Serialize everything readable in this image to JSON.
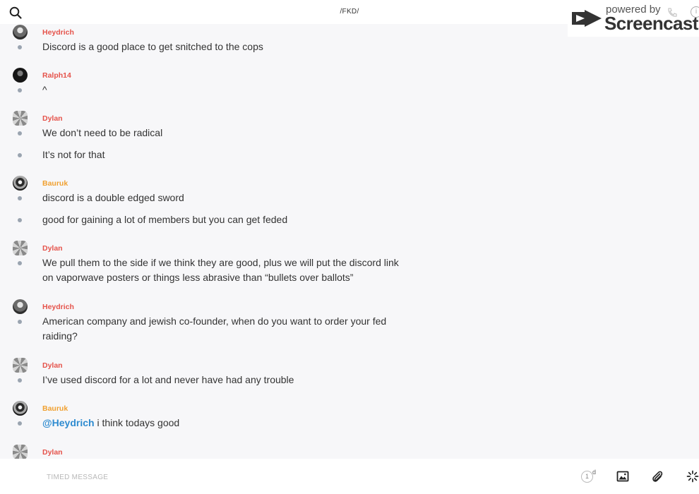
{
  "header": {
    "title": "/FKD/"
  },
  "watermark": {
    "powered": "powered by",
    "brand": "Screencastify"
  },
  "messages": [
    {
      "user": "Heydrich",
      "color": "red",
      "lines": [
        "Discord is a good place to get snitched to the cops"
      ]
    },
    {
      "user": "Ralph14",
      "color": "red",
      "lines": [
        "^"
      ]
    },
    {
      "user": "Dylan",
      "color": "red",
      "lines": [
        "We don’t need to be radical",
        "It’s not for that"
      ]
    },
    {
      "user": "Bauruk",
      "color": "orange",
      "lines": [
        "discord is a double edged sword",
        "good for gaining a lot of members but you can get feded"
      ]
    },
    {
      "user": "Dylan",
      "color": "red",
      "lines": [
        "We pull them to the side if we think they are good, plus we will put the discord link on vaporwave posters or things less abrasive than “bullets over ballots”"
      ]
    },
    {
      "user": "Heydrich",
      "color": "red",
      "lines": [
        "American company and jewish co-founder, when do you want to order your fed raiding?"
      ]
    },
    {
      "user": "Dylan",
      "color": "red",
      "lines": [
        "I’ve used discord for a lot and never have had any trouble"
      ]
    },
    {
      "user": "Bauruk",
      "color": "orange",
      "mention": "@Heydrich",
      "lines": [
        " i think todays good"
      ]
    },
    {
      "user": "Dylan",
      "color": "red",
      "lines": []
    }
  ],
  "composer": {
    "placeholder": "TIMED MESSAGE",
    "timer_value": "1",
    "timer_unit": "d"
  },
  "colors": {
    "red": "#e5534b",
    "orange": "#f0a030",
    "mention": "#2e8bd0",
    "accent": "#e5534b"
  },
  "icons": [
    "search-icon",
    "screencastify-logo",
    "phone-icon",
    "info-icon",
    "timer-icon",
    "image-icon",
    "paperclip-icon",
    "loading-spinner-icon"
  ]
}
